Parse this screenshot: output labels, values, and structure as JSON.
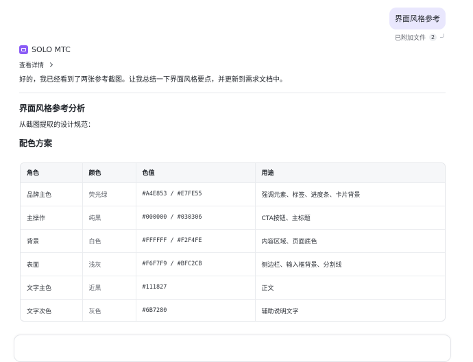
{
  "user_message": {
    "text": "界面风格参考",
    "attachments_label": "已附加文件",
    "attachments_count": "2"
  },
  "agent": {
    "name": "SOLO MTC",
    "details_label": "查看详情",
    "reply": "好的，我已经看到了两张参考截图。让我总结一下界面风格要点，并更新到需求文档中。"
  },
  "doc": {
    "heading": "界面风格参考分析",
    "intro": "从截图提取的设计规范：",
    "subheading": "配色方案",
    "table": {
      "headers": [
        "角色",
        "颜色",
        "色值",
        "用途"
      ],
      "rows": [
        [
          "品牌主色",
          "荧光绿",
          "#A4E853 / #E7FE55",
          "强调元素、标签、进度条、卡片背景"
        ],
        [
          "主操作",
          "纯黑",
          "#000000 / #030306",
          "CTA按钮、主标题"
        ],
        [
          "背景",
          "白色",
          "#FFFFFF / #F2F4FE",
          "内容区域、页面底色"
        ],
        [
          "表面",
          "浅灰",
          "#F6F7F9 / #BFC2CB",
          "侧边栏、输入框背景、分割线"
        ],
        [
          "文字主色",
          "近黑",
          "#111827",
          "正文"
        ],
        [
          "文字次色",
          "灰色",
          "#6B7280",
          "辅助说明文字"
        ]
      ]
    }
  }
}
